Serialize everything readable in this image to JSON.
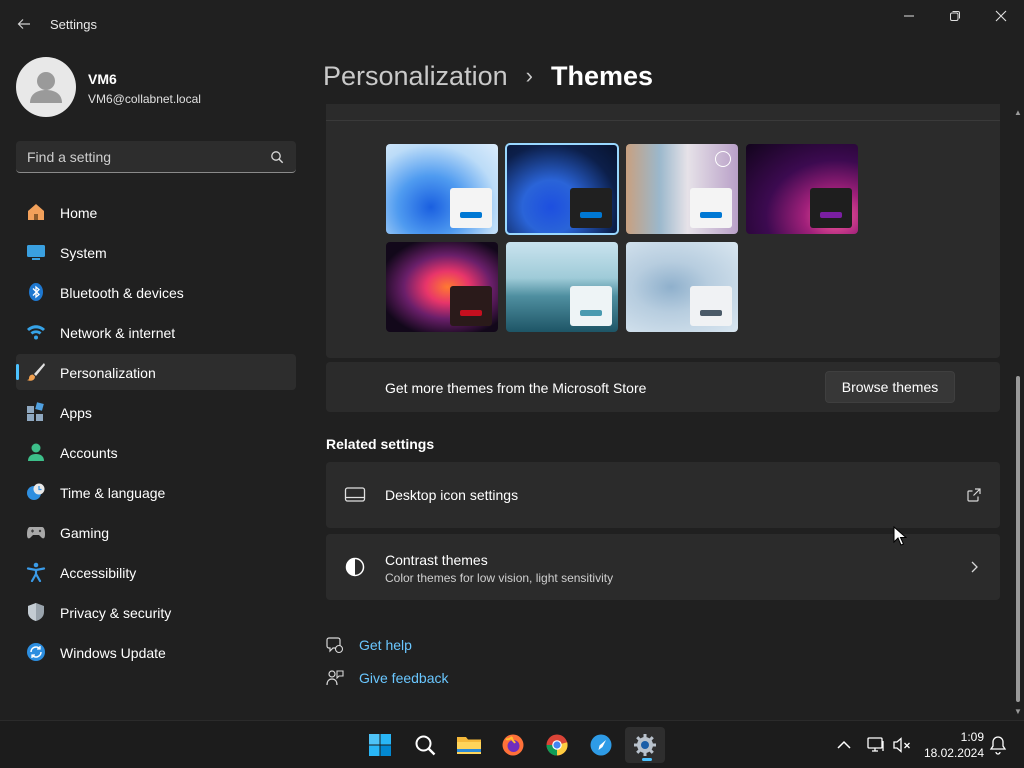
{
  "window": {
    "title": "Settings"
  },
  "profile": {
    "name": "VM6",
    "email": "VM6@collabnet.local"
  },
  "search": {
    "placeholder": "Find a setting"
  },
  "nav": {
    "items": [
      {
        "label": "Home",
        "icon": "home-icon"
      },
      {
        "label": "System",
        "icon": "system-icon"
      },
      {
        "label": "Bluetooth & devices",
        "icon": "bluetooth-icon"
      },
      {
        "label": "Network & internet",
        "icon": "wifi-icon"
      },
      {
        "label": "Personalization",
        "icon": "brush-icon",
        "active": true
      },
      {
        "label": "Apps",
        "icon": "apps-icon"
      },
      {
        "label": "Accounts",
        "icon": "accounts-icon"
      },
      {
        "label": "Time & language",
        "icon": "clock-globe-icon"
      },
      {
        "label": "Gaming",
        "icon": "gamepad-icon"
      },
      {
        "label": "Accessibility",
        "icon": "accessibility-icon"
      },
      {
        "label": "Privacy & security",
        "icon": "shield-icon"
      },
      {
        "label": "Windows Update",
        "icon": "update-icon"
      }
    ]
  },
  "breadcrumb": {
    "parent": "Personalization",
    "separator": "›",
    "current": "Themes"
  },
  "themes": {
    "selected_index": 1,
    "items": [
      {
        "name": "windows-light",
        "accent": "#0078d4"
      },
      {
        "name": "windows-dark",
        "accent": "#0078d4"
      },
      {
        "name": "windows-spotlight",
        "accent": "#0078d4"
      },
      {
        "name": "glow",
        "accent": "#7a1fa2"
      },
      {
        "name": "captured-motion",
        "accent": "#c50f1f"
      },
      {
        "name": "sunrise",
        "accent": "#4a9ab0"
      },
      {
        "name": "flow",
        "accent": "#4a5a68"
      }
    ]
  },
  "store": {
    "text": "Get more themes from the Microsoft Store",
    "button_label": "Browse themes"
  },
  "related": {
    "heading": "Related settings",
    "desktop_icons": {
      "title": "Desktop icon settings"
    },
    "contrast": {
      "title": "Contrast themes",
      "subtitle": "Color themes for low vision, light sensitivity"
    }
  },
  "help": {
    "get_help": "Get help",
    "give_feedback": "Give feedback"
  },
  "taskbar": {
    "time": "1:09",
    "date": "18.02.2024"
  },
  "colors": {
    "accent": "#4cc2ff",
    "link": "#6ac7ff",
    "background": "#202020",
    "card": "#2b2b2b"
  }
}
